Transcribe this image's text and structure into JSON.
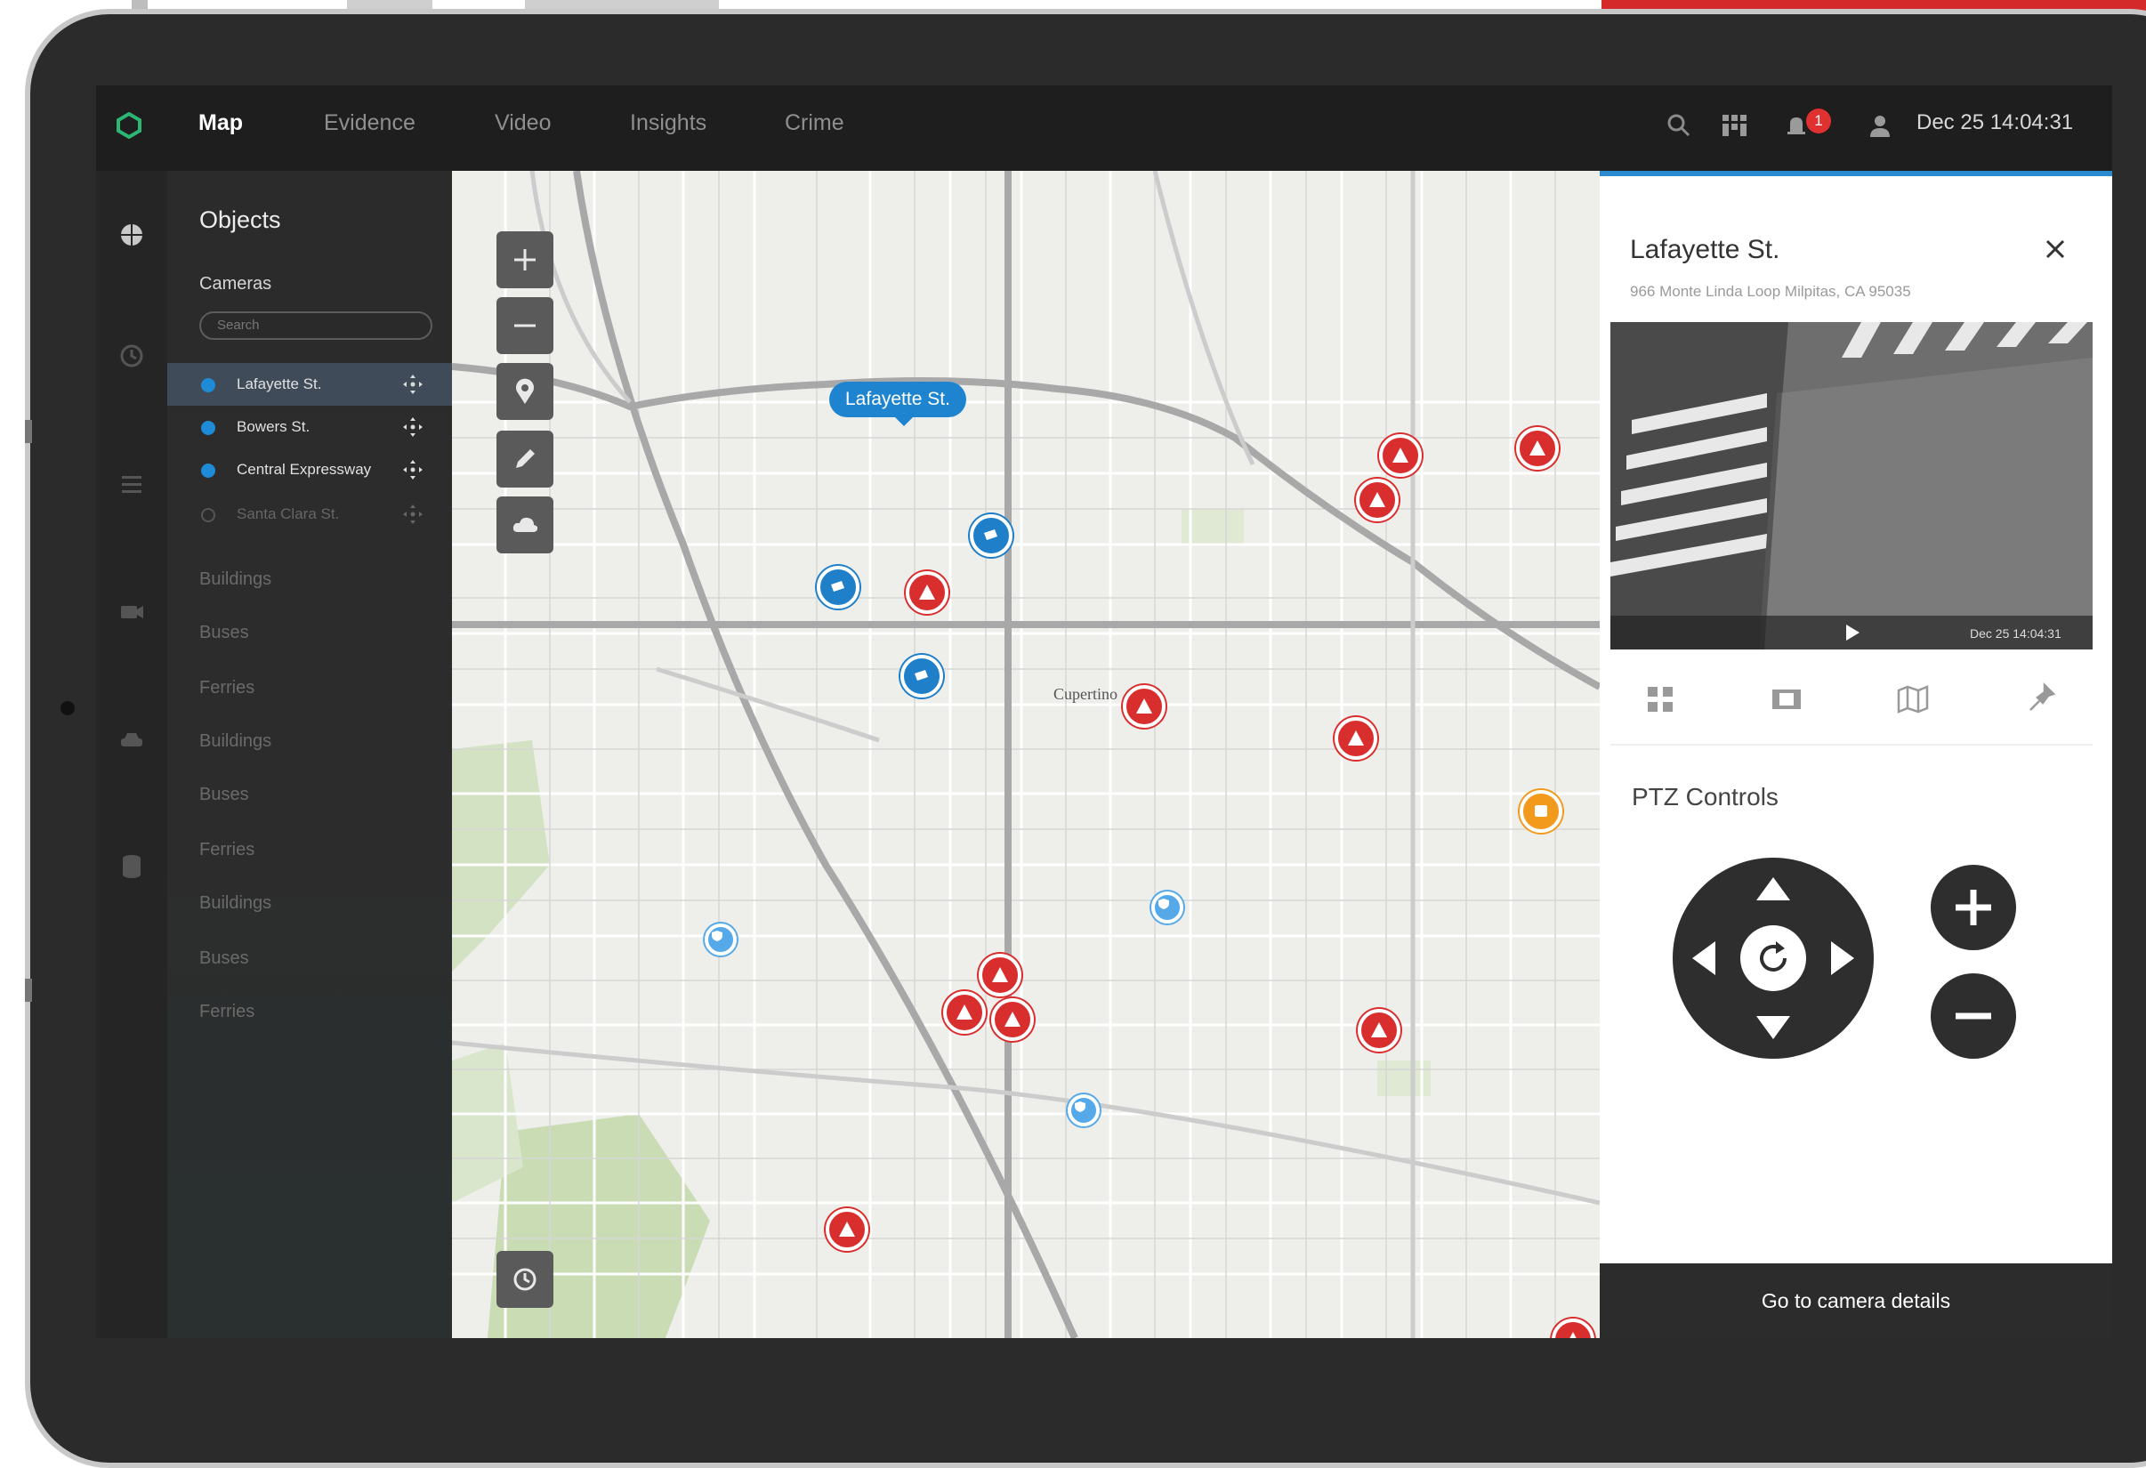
{
  "nav": {
    "items": [
      {
        "label": "Map",
        "active": true
      },
      {
        "label": "Evidence",
        "active": false
      },
      {
        "label": "Video",
        "active": false
      },
      {
        "label": "Insights",
        "active": false
      },
      {
        "label": "Crime",
        "active": false
      }
    ],
    "alert_count": "1",
    "datetime": "Dec 25 14:04:31"
  },
  "objects": {
    "title": "Objects",
    "cameras_label": "Cameras",
    "search_placeholder": "Search",
    "cameras": [
      {
        "name": "Lafayette St.",
        "selected": true,
        "active": true
      },
      {
        "name": "Bowers St.",
        "selected": false,
        "active": true
      },
      {
        "name": "Central Expressway",
        "selected": false,
        "active": true
      },
      {
        "name": "Santa Clara St.",
        "selected": false,
        "active": false
      }
    ],
    "categories": [
      "Buildings",
      "Buses",
      "Ferries",
      "Buildings",
      "Buses",
      "Ferries",
      "Buildings",
      "Buses",
      "Ferries"
    ]
  },
  "map": {
    "callout": "Lafayette St.",
    "city_label": "Cupertino"
  },
  "details": {
    "title": "Lafayette St.",
    "address": "966 Monte Linda Loop Milpitas, CA 95035",
    "video_timestamp": "Dec 25 14:04:31",
    "ptz_title": "PTZ Controls",
    "go_button": "Go to camera details"
  },
  "colors": {
    "accent": "#1f84cf",
    "alert_red": "#d92e2e",
    "warning_orange": "#f19a1b",
    "brand_green": "#2bb673"
  }
}
